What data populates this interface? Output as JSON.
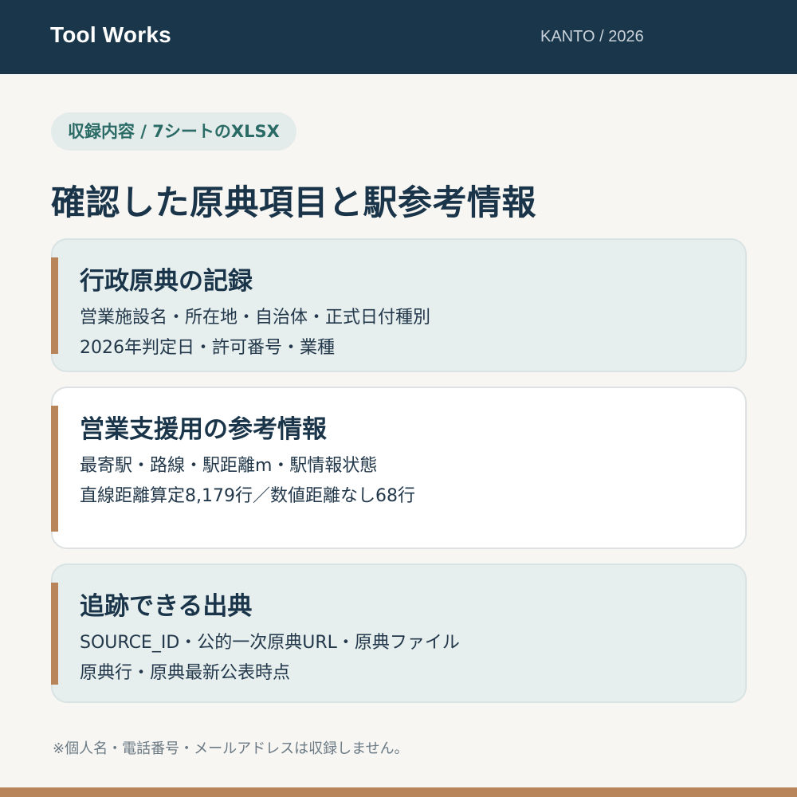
{
  "header": {
    "brand": "Tool Works",
    "region": "KANTO / 2026"
  },
  "badge": "収録内容 / 7シートのXLSX",
  "title": "確認した原典項目と駅参考情報",
  "cards": [
    {
      "title": "行政原典の記録",
      "lines": [
        "営業施設名・所在地・自治体・正式日付種別",
        "2026年判定日・許可番号・業種"
      ]
    },
    {
      "title": "営業支援用の参考情報",
      "lines": [
        "最寄駅・路線・駅距離m・駅情報状態",
        "直線距離算定8,179行／数値距離なし68行"
      ]
    },
    {
      "title": "追跡できる出典",
      "lines": [
        "SOURCE_ID・公的一次原典URL・原典ファイル",
        "原典行・原典最新公表時点"
      ]
    }
  ],
  "footnote": "※個人名・電話番号・メールアドレスは収録しません。",
  "colors": {
    "header_bg": "#1a364b",
    "accent": "#b8845a",
    "badge_text": "#2b6b66",
    "card_bg": "#e6eeee",
    "card_bg_alt": "#ffffff",
    "page_bg": "#f7f6f3"
  }
}
